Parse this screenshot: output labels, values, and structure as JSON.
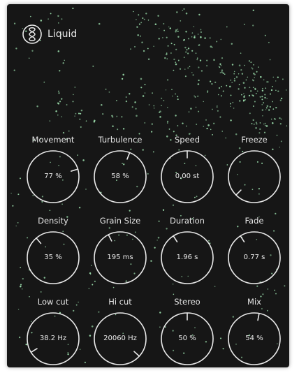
{
  "app": {
    "title": "Liquid",
    "logo_icon": "liquid-logo-icon"
  },
  "colors": {
    "background": "#161616",
    "ring": "#eaeaea",
    "particle": "#9fe3b0",
    "text": "#e6e6e6"
  },
  "knobs": [
    {
      "name": "movement",
      "label": "Movement",
      "value": "77 %",
      "position": 0.77
    },
    {
      "name": "turbulence",
      "label": "Turbulence",
      "value": "58 %",
      "position": 0.58
    },
    {
      "name": "speed",
      "label": "Speed",
      "value": "0,00 st",
      "position": 0.5
    },
    {
      "name": "freeze",
      "label": "Freeze",
      "value": "",
      "position": 0.0
    },
    {
      "name": "density",
      "label": "Density",
      "value": "35 %",
      "position": 0.35
    },
    {
      "name": "grain-size",
      "label": "Grain Size",
      "value": "195 ms",
      "position": 0.4
    },
    {
      "name": "duration",
      "label": "Duration",
      "value": "1.96 s",
      "position": 0.38
    },
    {
      "name": "fade",
      "label": "Fade",
      "value": "0.77 s",
      "position": 0.38
    },
    {
      "name": "low-cut",
      "label": "Low cut",
      "value": "38.2 Hz",
      "position": 0.05
    },
    {
      "name": "hi-cut",
      "label": "Hi cut",
      "value": "20060 Hz",
      "position": 0.99
    },
    {
      "name": "stereo",
      "label": "Stereo",
      "value": "50 %",
      "position": 0.5
    },
    {
      "name": "mix",
      "label": "Mix",
      "value": "54 %",
      "position": 0.54
    }
  ]
}
